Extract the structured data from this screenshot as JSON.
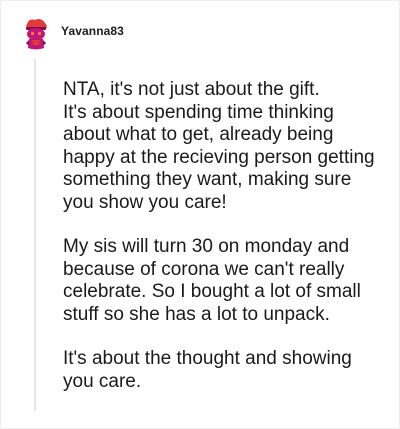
{
  "comment": {
    "username": "Yavanna83",
    "paragraphs": [
      "NTA, it's not just about the gift.\nIt's about spending time thinking about what to get, already being happy at the recieving person getting something they want, making sure you show you care!",
      "My sis will turn 30 on monday and because of corona we can't really celebrate. So I bought a lot of small stuff so she has a lot to unpack.",
      "It's about the thought and showing you care."
    ]
  },
  "colors": {
    "avatar_primary": "#c2177a",
    "avatar_accent": "#e03a3a",
    "thread_line": "#e5e5e5",
    "text": "#1a1a1a"
  },
  "icons": {
    "avatar": "reddit-snoo-avatar-icon"
  }
}
